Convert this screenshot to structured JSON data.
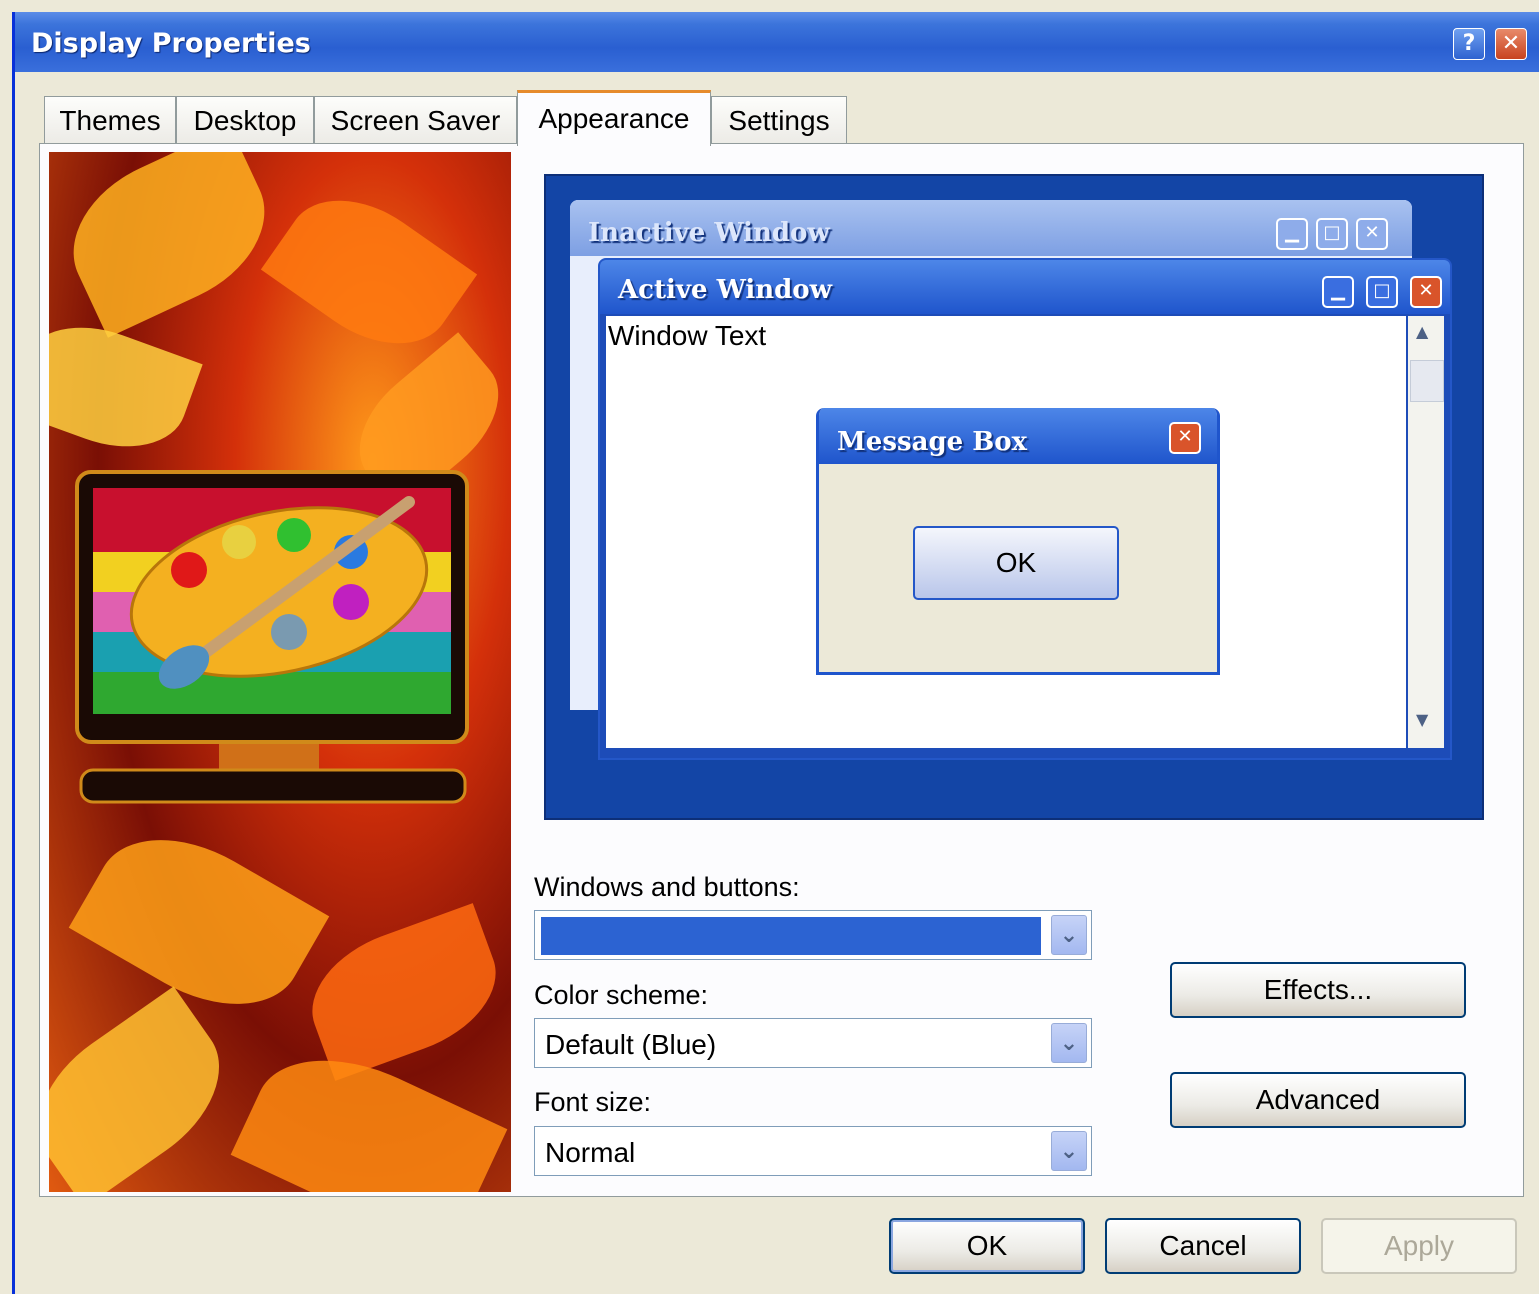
{
  "window": {
    "title": "Display Properties",
    "help_glyph": "?",
    "close_glyph": "✕"
  },
  "tabs": [
    {
      "label": "Themes"
    },
    {
      "label": "Desktop"
    },
    {
      "label": "Screen Saver"
    },
    {
      "label": "Appearance",
      "active": true
    },
    {
      "label": "Settings"
    }
  ],
  "preview": {
    "inactive_title": "Inactive Window",
    "active_title": "Active Window",
    "window_text": "Window Text",
    "message_title": "Message Box",
    "message_ok": "OK",
    "min_glyph": "▁",
    "max_glyph": "□",
    "close_glyph": "✕",
    "scroll_up": "▲",
    "scroll_down": "▼"
  },
  "form": {
    "windows_buttons_label": "Windows and buttons:",
    "windows_buttons_value": "",
    "color_scheme_label": "Color scheme:",
    "color_scheme_value": "Default (Blue)",
    "font_size_label": "Font size:",
    "font_size_value": "Normal",
    "dropdown_glyph": "⌄"
  },
  "buttons": {
    "effects": "Effects...",
    "advanced": "Advanced",
    "ok": "OK",
    "cancel": "Cancel",
    "apply": "Apply"
  },
  "colors": {
    "xp_blue": "#0831d9",
    "selected_style": "#2c63d2",
    "accent_tab": "#e68b2c"
  }
}
